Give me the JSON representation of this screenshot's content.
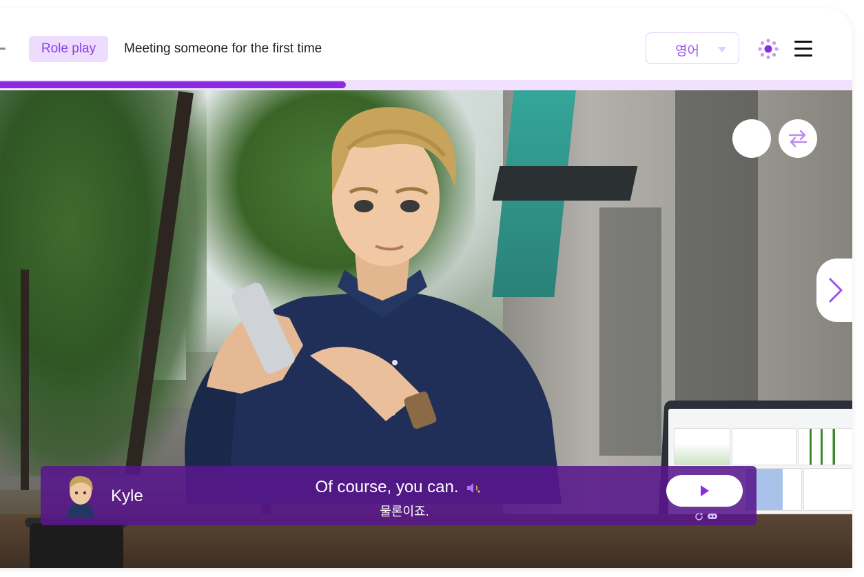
{
  "header": {
    "badge_label": "Role play",
    "lesson_title": "Meeting someone for the first time",
    "language_select": {
      "value": "영어"
    }
  },
  "progress": {
    "fraction": 0.42
  },
  "subtitle": {
    "speaker": "Kyle",
    "english": "Of course, you can.",
    "korean": "물론이죠."
  },
  "colors": {
    "accent": "#8a2be2",
    "badge_bg": "#eedcff",
    "subtitle_bg": "#58178c"
  },
  "icons": {
    "settings": "settings-dots-icon",
    "menu": "hamburger-icon",
    "swap": "swap-arrows-icon",
    "next": "chevron-right-icon",
    "speaker": "speaker-icon",
    "play": "play-icon"
  }
}
